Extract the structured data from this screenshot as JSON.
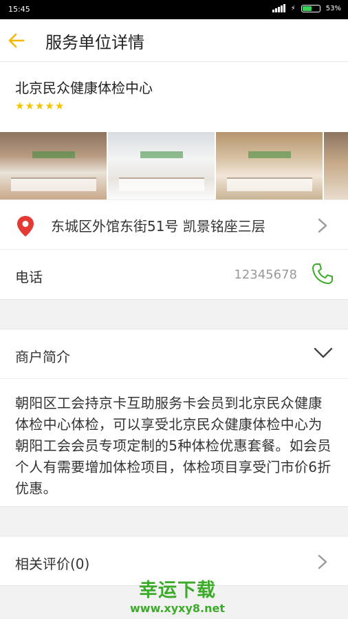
{
  "status_bar": {
    "time": "15:45",
    "battery": "53%",
    "battery_level": 0.53
  },
  "header": {
    "title": "服务单位详情",
    "back_icon": "arrow-left-icon"
  },
  "shop": {
    "name": "北京民众健康体检中心",
    "rating": 5,
    "max_rating": 5,
    "star_color": "#f5c400"
  },
  "address": {
    "text": "东城区外馆东街51号 凯景铭座三层",
    "icon": "location-pin-icon",
    "pin_color": "#e53935"
  },
  "phone": {
    "label": "电话",
    "number": "12345678",
    "icon": "phone-icon",
    "icon_color": "#3cab2a"
  },
  "intro": {
    "label": "商户简介",
    "text": "朝阳区工会持京卡互助服务卡会员到北京民众健康体检中心体检，可以享受北京民众健康体检中心为朝阳工会会员专项定制的5种体检优惠套餐。如会员个人有需要增加体检项目，体检项目享受门市价6折优惠。"
  },
  "reviews": {
    "label": "相关评价(0)"
  },
  "watermark": {
    "line1": "幸运下载",
    "line2": "www.xyxy8.net"
  },
  "accent_color": "#f5b800"
}
